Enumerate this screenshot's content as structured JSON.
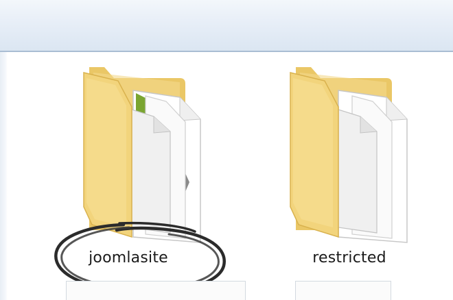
{
  "colors": {
    "toolbar_top": "#f3f7fb",
    "toolbar_bottom": "#dbe6f2",
    "toolbar_border": "#a9bdd3",
    "folder_yellow": "#f5d983",
    "folder_dark_yellow": "#e2bc55",
    "circle_ink": "#2b2b2b"
  },
  "folders": [
    {
      "name": "joomlasite",
      "icon": "folder-with-documents-icon",
      "highlighted": true
    },
    {
      "name": "restricted",
      "icon": "folder-with-documents-icon",
      "highlighted": false
    }
  ]
}
